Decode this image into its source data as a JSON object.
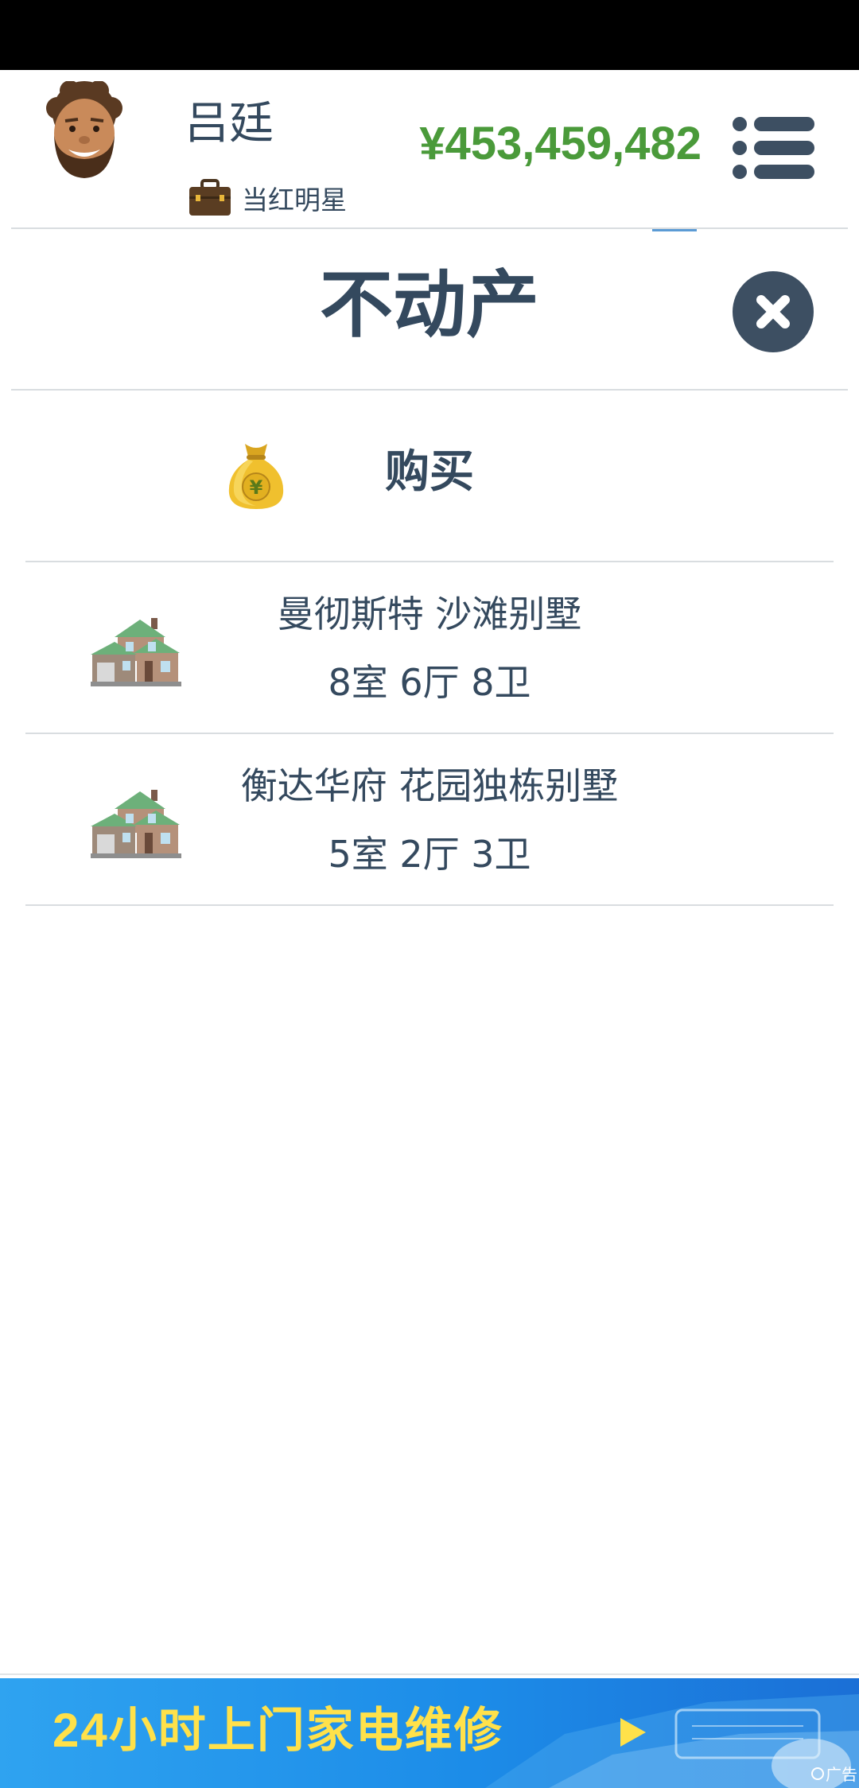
{
  "player": {
    "name": "吕廷",
    "job": "当红明星",
    "money": "¥453,459,482"
  },
  "panel": {
    "title": "不动产",
    "buy_label": "购买"
  },
  "properties": [
    {
      "name": "曼彻斯特 沙滩别墅",
      "rooms": "8室 6厅 8卫"
    },
    {
      "name": "衡达华府 花园独栋别墅",
      "rooms": "5室 2厅 3卫"
    }
  ],
  "ad": {
    "text": "24小时上门家电维修",
    "badge": "广告"
  },
  "colors": {
    "money": "#4a9a3a",
    "text": "#34495e",
    "ad_text": "#ffe14a",
    "ad_background": "#1c8ce8"
  },
  "icons": [
    "avatar",
    "briefcase-icon",
    "menu-icon",
    "close-icon",
    "money-bag-icon",
    "house-icon",
    "play-icon"
  ]
}
